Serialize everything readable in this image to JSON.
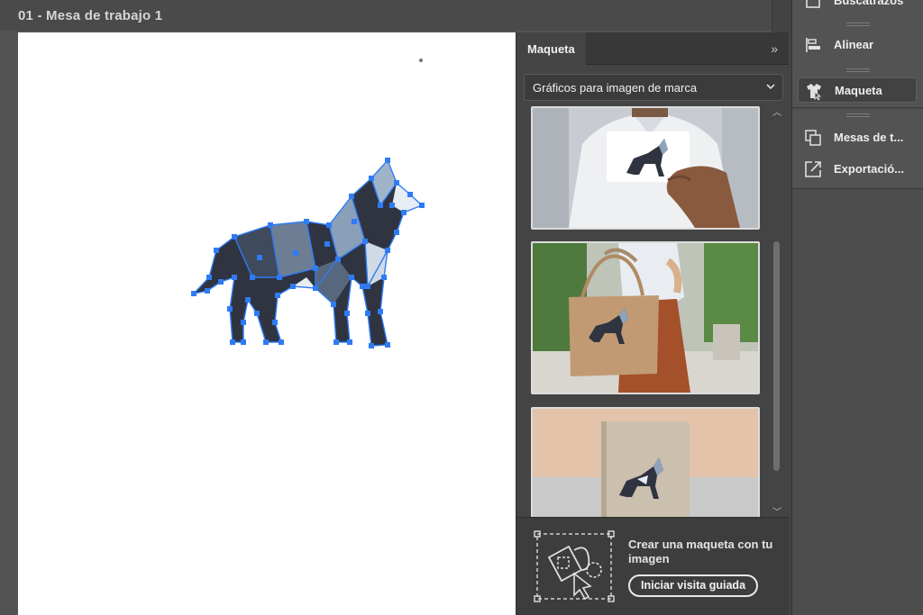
{
  "document": {
    "title": "01 - Mesa de trabajo 1"
  },
  "mockup_panel": {
    "tab_label": "Maqueta",
    "collapse_icon": "double-chevron-right-icon",
    "category_select": {
      "selected": "Gráficos para imagen de marca"
    },
    "thumbnails": [
      {
        "scene": "business-card"
      },
      {
        "scene": "tote-bag"
      },
      {
        "scene": "notebook"
      }
    ],
    "footer": {
      "text": "Crear una maqueta con tu imagen",
      "button_label": "Iniciar visita guiada"
    }
  },
  "dock": {
    "items": [
      {
        "label": "Buscatrazos",
        "icon": "image-trace-icon"
      },
      {
        "label": "Alinear",
        "icon": "align-icon"
      },
      {
        "label": "Maqueta",
        "icon": "mockup-icon",
        "active": true
      },
      {
        "label": "Mesas de t...",
        "icon": "artboards-icon"
      },
      {
        "label": "Exportació...",
        "icon": "export-icon"
      }
    ]
  },
  "colors": {
    "selection_blue": "#2f7bf5",
    "wolf_dark": "#2f3440",
    "wolf_light": "#9fb4c9"
  }
}
